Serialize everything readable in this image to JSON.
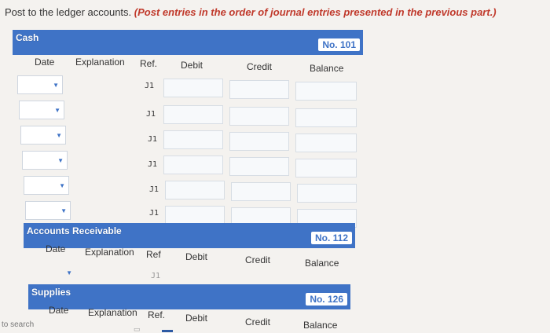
{
  "instruction": {
    "text": "Post to the ledger accounts. ",
    "emphasis": "(Post entries in the order of journal entries presented in the previous part.)"
  },
  "cash": {
    "title": "Cash",
    "number": "No. 101",
    "columns": {
      "date": "Date",
      "explanation": "Explanation",
      "ref": "Ref.",
      "debit": "Debit",
      "credit": "Credit",
      "balance": "Balance"
    },
    "rows": [
      {
        "ref": "J1"
      },
      {
        "ref": "J1"
      },
      {
        "ref": "J1"
      },
      {
        "ref": "J1"
      },
      {
        "ref": "J1"
      },
      {
        "ref": "J1"
      }
    ]
  },
  "accounts_receivable": {
    "title": "Accounts Receivable",
    "number": "No. 112",
    "columns": {
      "date": "Date",
      "explanation": "Explanation",
      "ref": "Ref",
      "debit": "Debit",
      "credit": "Credit",
      "balance": "Balance"
    },
    "rows": [
      {
        "ref": "J1"
      }
    ]
  },
  "supplies": {
    "title": "Supplies",
    "number": "No. 126",
    "columns": {
      "date": "Date",
      "explanation": "Explanation",
      "ref": "Ref.",
      "debit": "Debit",
      "credit": "Credit",
      "balance": "Balance"
    }
  },
  "taskbar": {
    "search": "to search"
  },
  "icons": {
    "dropdown": "dropdown-arrow-icon"
  },
  "colors": {
    "header": "#3f73c6",
    "emphasis": "#c0392b"
  }
}
